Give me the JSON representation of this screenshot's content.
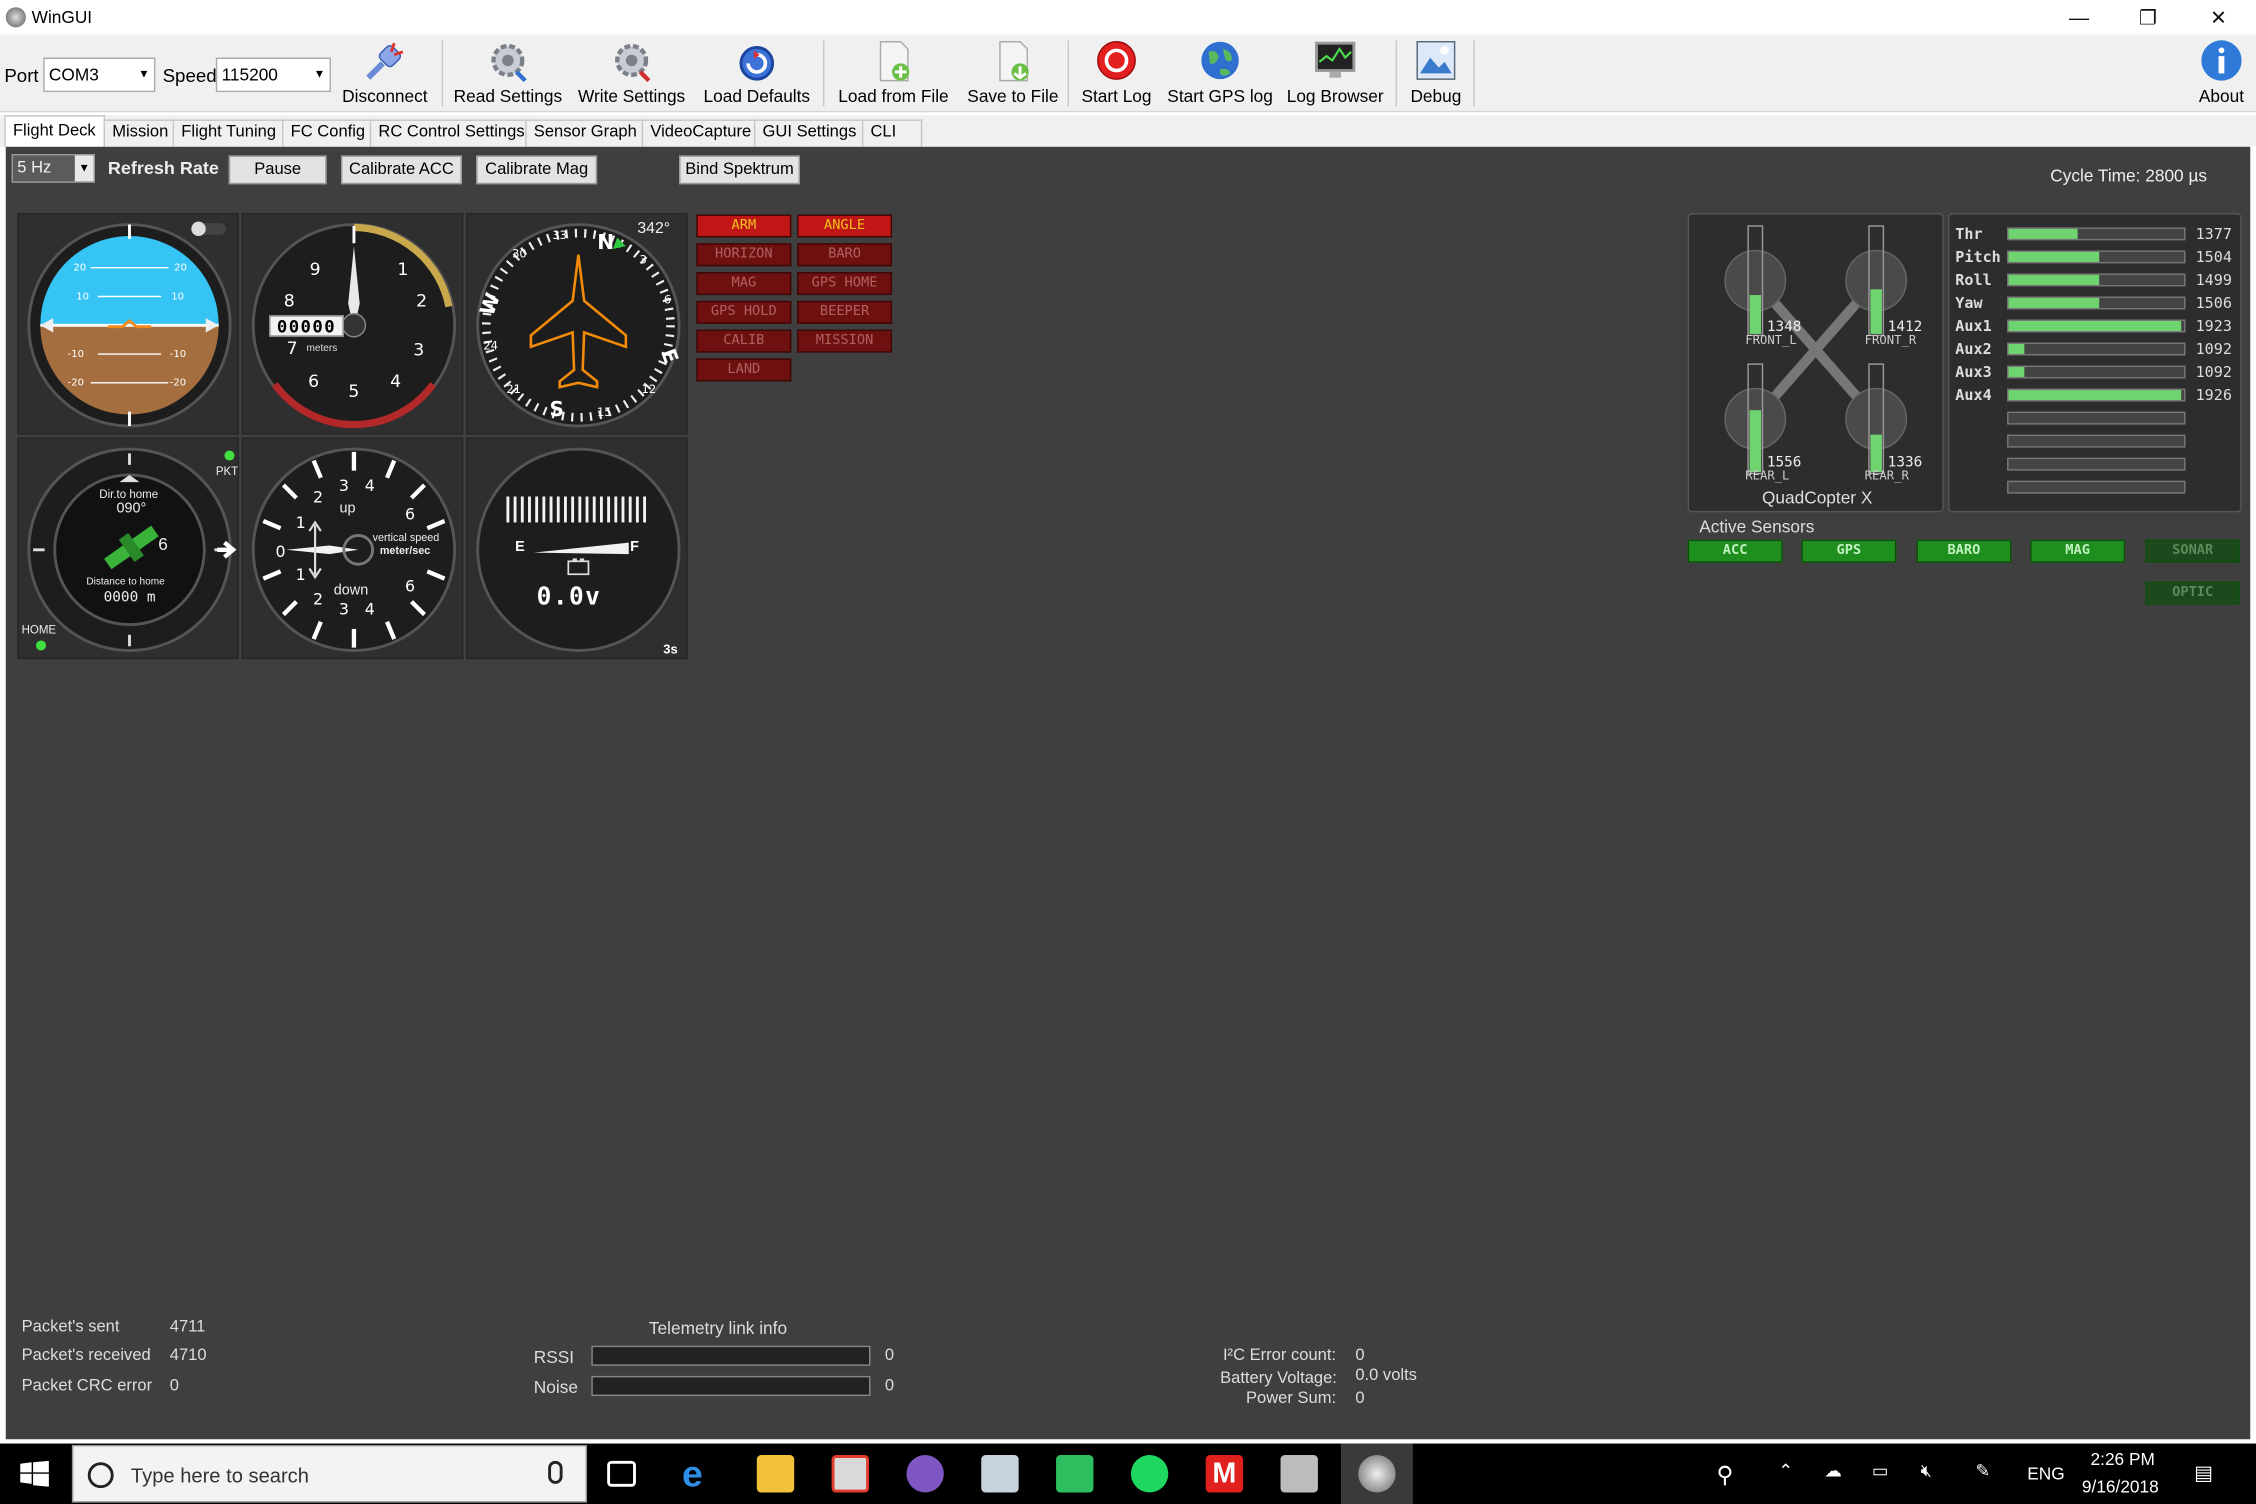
{
  "window": {
    "title": "WinGUI",
    "minimize": "—",
    "maximize": "❐",
    "close": "✕"
  },
  "toolbar": {
    "port_label": "Port",
    "port_value": "COM3",
    "speed_label": "Speed",
    "speed_value": "115200",
    "buttons": [
      {
        "label": "Disconnect",
        "icon": "plug-icon"
      },
      {
        "label": "Read Settings",
        "icon": "gear-read-icon"
      },
      {
        "label": "Write Settings",
        "icon": "gear-write-icon"
      },
      {
        "label": "Load Defaults",
        "icon": "reset-icon"
      },
      {
        "label": "Load from File",
        "icon": "file-load-icon"
      },
      {
        "label": "Save to File",
        "icon": "file-save-icon"
      },
      {
        "label": "Start Log",
        "icon": "record-icon"
      },
      {
        "label": "Start GPS log",
        "icon": "globe-icon"
      },
      {
        "label": "Log Browser",
        "icon": "monitor-icon"
      },
      {
        "label": "Debug",
        "icon": "picture-icon"
      },
      {
        "label": "About",
        "icon": "info-icon"
      }
    ]
  },
  "tabs": [
    "Flight Deck",
    "Mission",
    "Flight Tuning",
    "FC Config",
    "RC Control Settings",
    "Sensor Graph",
    "VideoCapture",
    "GUI Settings",
    "CLI"
  ],
  "controls": {
    "rate_value": "5 Hz",
    "refresh_label": "Refresh Rate",
    "pause": "Pause",
    "calibrate_acc": "Calibrate ACC",
    "calibrate_mag": "Calibrate Mag",
    "bind_spektrum": "Bind Spektrum",
    "cycle_time": "Cycle Time:  2800 µs"
  },
  "gauges": {
    "altimeter_unit": "meters",
    "altimeter_digits": "00000",
    "heading_value": "342°",
    "gps_dir_label": "Dir.to home",
    "gps_dir_value": "090°",
    "gps_sats": "6",
    "gps_dist_label": "Distance to home",
    "gps_dist_value": "0000 m",
    "gps_pkt": "PKT",
    "gps_home": "HOME",
    "vario_up": "up",
    "vario_down": "down",
    "vario_label": "vertical speed",
    "vario_unit": "meter/sec",
    "battery_e": "E",
    "battery_f": "F",
    "battery_voltage": "0.0v",
    "battery_cells": "3s"
  },
  "modes": [
    {
      "label": "ARM",
      "on": true
    },
    {
      "label": "ANGLE",
      "on": true
    },
    {
      "label": "HORIZON",
      "on": false
    },
    {
      "label": "BARO",
      "on": false
    },
    {
      "label": "MAG",
      "on": false
    },
    {
      "label": "GPS HOME",
      "on": false
    },
    {
      "label": "GPS HOLD",
      "on": false
    },
    {
      "label": "BEEPER",
      "on": false
    },
    {
      "label": "CALIB",
      "on": false
    },
    {
      "label": "MISSION",
      "on": false
    },
    {
      "label": "LAND",
      "on": false
    }
  ],
  "motors": {
    "front_l": "1348",
    "front_l_label": "FRONT_L",
    "front_r": "1412",
    "front_r_label": "FRONT_R",
    "rear_l": "1556",
    "rear_l_label": "REAR_L",
    "rear_r": "1336",
    "rear_r_label": "REAR_R",
    "frame": "QuadCopter X"
  },
  "rc_channels": [
    {
      "name": "Thr",
      "value": "1377"
    },
    {
      "name": "Pitch",
      "value": "1504"
    },
    {
      "name": "Roll",
      "value": "1499"
    },
    {
      "name": "Yaw",
      "value": "1506"
    },
    {
      "name": "Aux1",
      "value": "1923"
    },
    {
      "name": "Aux2",
      "value": "1092"
    },
    {
      "name": "Aux3",
      "value": "1092"
    },
    {
      "name": "Aux4",
      "value": "1926"
    }
  ],
  "sensors": {
    "title": "Active Sensors",
    "items": [
      {
        "label": "ACC",
        "on": true
      },
      {
        "label": "GPS",
        "on": true
      },
      {
        "label": "BARO",
        "on": true
      },
      {
        "label": "MAG",
        "on": true
      },
      {
        "label": "SONAR",
        "on": false
      },
      {
        "label": "OPTIC",
        "on": false
      }
    ]
  },
  "stats": {
    "sent_label": "Packet's sent",
    "sent_value": "4711",
    "recv_label": "Packet's received",
    "recv_value": "4710",
    "crc_label": "Packet CRC error",
    "crc_value": "0",
    "telemetry_title": "Telemetry link info",
    "rssi_label": "RSSI",
    "rssi_value": "0",
    "noise_label": "Noise",
    "noise_value": "0",
    "i2c_label": "I²C Error count:",
    "i2c_value": "0",
    "batt_label": "Battery Voltage:",
    "batt_value": "0.0 volts",
    "power_label": "Power Sum:",
    "power_value": "0"
  },
  "taskbar": {
    "search_placeholder": "Type here to search",
    "lang": "ENG",
    "time": "2:26 PM",
    "date": "9/16/2018"
  },
  "colors": {
    "panel_bg": "#3f3f3f",
    "mode_on": "#c01616",
    "mode_off": "#6e1010",
    "sensor_on": "#1e8f1e",
    "bar_green": "#6fd36f"
  }
}
